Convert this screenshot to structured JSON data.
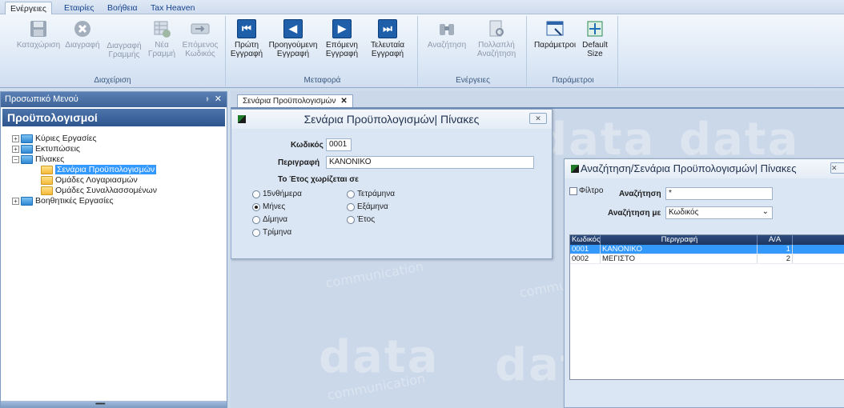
{
  "ribbon": {
    "tabs": [
      "Ενέργειες",
      "Εταιρίες",
      "Βοήθεια",
      "Tax Heaven"
    ],
    "groups": {
      "management": {
        "label": "Διαχείριση",
        "buttons": {
          "save": [
            "Καταχώριση"
          ],
          "delete": [
            "Διαγραφή"
          ],
          "delete_line": [
            "Διαγραφή",
            "Γραμμής"
          ],
          "new_line": [
            "Νέα",
            "Γραμμή"
          ],
          "next_code": [
            "Επόμενος",
            "Κωδικός"
          ]
        }
      },
      "navigation": {
        "label": "Μεταφορά",
        "buttons": {
          "first": [
            "Πρώτη",
            "Εγγραφή"
          ],
          "previous": [
            "Προηγούμενη",
            "Εγγραφή"
          ],
          "next": [
            "Επόμενη",
            "Εγγραφή"
          ],
          "last": [
            "Τελευταία",
            "Εγγραφή"
          ]
        }
      },
      "actions": {
        "label": "Ενέργειες",
        "buttons": {
          "search": [
            "Αναζήτηση"
          ],
          "multi_search": [
            "Πολλαπλή",
            "Αναζήτηση"
          ]
        }
      },
      "parameters": {
        "label": "Παράμετροι",
        "buttons": {
          "params": [
            "Παράμετροι"
          ],
          "default_size": [
            "Default",
            "Size"
          ]
        }
      }
    }
  },
  "left_panel": {
    "header": "Προσωπικό Μενού",
    "pin": "ᅡ",
    "close": "✕",
    "title": "Προϋπολογισμοί",
    "tree": {
      "core_tasks": "Κύριες Εργασίες",
      "prints": "Εκτυπώσεις",
      "tables": "Πίνακες",
      "budget_scenarios": "Σενάρια Προϋπολογισμών",
      "account_groups": "Ομάδες Λογαριασμών",
      "counterparty_groups": "Ομάδες Συναλλασσομένων",
      "helper_tasks": "Βοηθητικές Εργασίες"
    }
  },
  "workspace": {
    "doc_tab": "Σενάρια Προϋπολογισμών",
    "watermark_main": "data",
    "watermark_sub": "communication"
  },
  "dialog_main": {
    "title": "Σενάρια Προϋπολογισμών| Πίνακες",
    "code_label": "Κωδικός",
    "code_value": "0001",
    "desc_label": "Περιγραφή",
    "desc_value": "ΚΑΝΟΝΙΚΟ",
    "split_label": "Το Έτος χωρίζεται σε",
    "options": {
      "fortnights": "15νθήμερα",
      "months": "Μήνες",
      "bimonthly": "Δίμηνα",
      "quarters": "Τρίμηνα",
      "four_months": "Τετράμηνα",
      "semesters": "Εξάμηνα",
      "year": "Έτος"
    },
    "selected": "months"
  },
  "dialog_search": {
    "title": "Αναζήτηση/Σενάρια Προϋπολογισμών| Πίνακες",
    "filter_label": "Φίλτρο",
    "search_label": "Αναζήτηση",
    "search_value": "*",
    "search_by_label": "Αναζήτηση με",
    "search_by_value": "Κωδικός",
    "columns": [
      "Κωδικός",
      "Περιγραφή",
      "Α/Α"
    ],
    "rows": [
      {
        "code": "0001",
        "description": "ΚΑΝΟΝΙΚΟ",
        "aa": "1"
      },
      {
        "code": "0002",
        "description": "ΜΕΓΙΣΤΟ",
        "aa": "2"
      }
    ]
  }
}
